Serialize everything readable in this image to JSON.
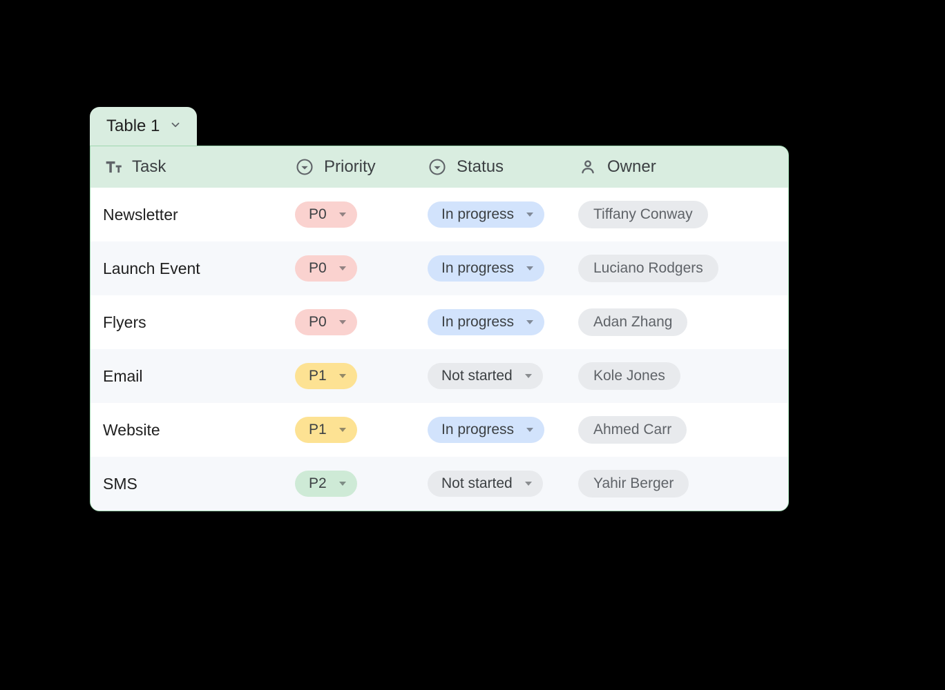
{
  "tab": {
    "label": "Table 1"
  },
  "columns": {
    "task": "Task",
    "priority": "Priority",
    "status": "Status",
    "owner": "Owner"
  },
  "priority_colors": {
    "P0": "#fad2cf",
    "P1": "#fde293",
    "P2": "#ceead6"
  },
  "status_colors": {
    "In progress": "#d2e3fc",
    "Not started": "#e8eaed"
  },
  "rows": [
    {
      "task": "Newsletter",
      "priority": "P0",
      "status": "In progress",
      "owner": "Tiffany Conway"
    },
    {
      "task": "Launch Event",
      "priority": "P0",
      "status": "In progress",
      "owner": "Luciano Rodgers"
    },
    {
      "task": "Flyers",
      "priority": "P0",
      "status": "In progress",
      "owner": "Adan Zhang"
    },
    {
      "task": "Email",
      "priority": "P1",
      "status": "Not started",
      "owner": "Kole Jones"
    },
    {
      "task": "Website",
      "priority": "P1",
      "status": "In progress",
      "owner": "Ahmed Carr"
    },
    {
      "task": "SMS",
      "priority": "P2",
      "status": "Not started",
      "owner": "Yahir Berger"
    }
  ]
}
